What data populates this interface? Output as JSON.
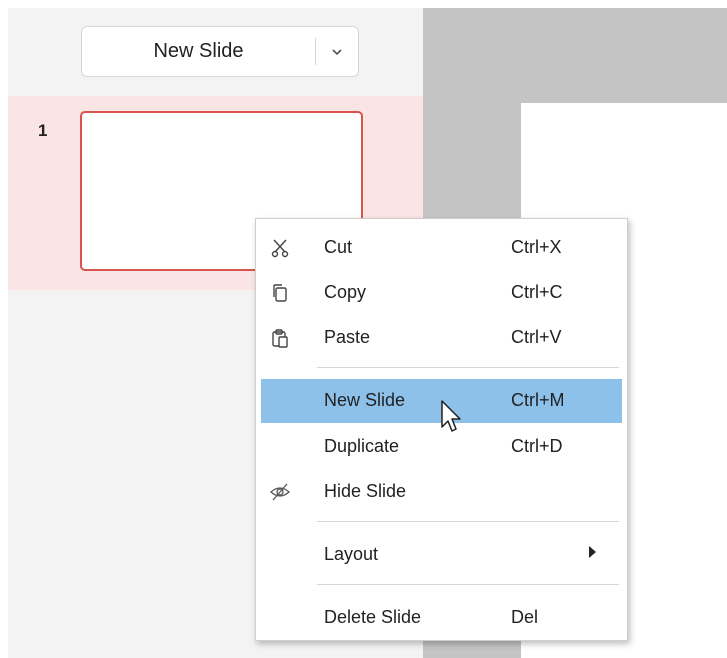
{
  "toolbar": {
    "new_slide_label": "New Slide",
    "dropdown_icon": "chevron-down"
  },
  "slides": [
    {
      "number": "1"
    }
  ],
  "colors": {
    "selection_accent": "#d9534f",
    "selection_row": "#fae4e4",
    "menu_highlight": "#8ec1ea"
  },
  "context_menu": {
    "items": [
      {
        "label": "Cut",
        "shortcut": "Ctrl+X",
        "icon": "scissors-icon"
      },
      {
        "label": "Copy",
        "shortcut": "Ctrl+C",
        "icon": "copy-icon"
      },
      {
        "label": "Paste",
        "shortcut": "Ctrl+V",
        "icon": "clipboard-icon"
      },
      {
        "label": "New Slide",
        "shortcut": "Ctrl+M",
        "highlighted": true
      },
      {
        "label": "Duplicate",
        "shortcut": "Ctrl+D"
      },
      {
        "label": "Hide Slide",
        "icon": "eye-slash-icon"
      },
      {
        "label": "Layout",
        "submenu": true
      },
      {
        "label": "Delete Slide",
        "shortcut": "Del"
      }
    ]
  }
}
